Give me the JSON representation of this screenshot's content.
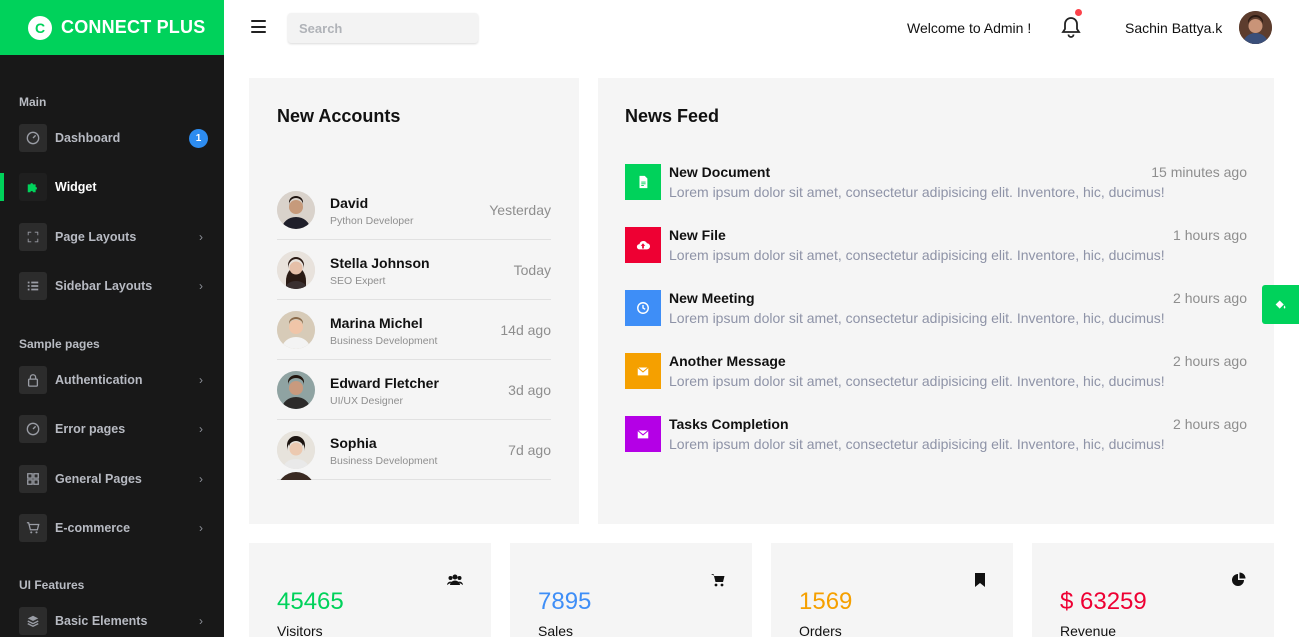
{
  "brand": {
    "name": "CONNECT PLUS",
    "logo_letter": "C"
  },
  "sidebar": {
    "sections": [
      {
        "title": "Main"
      },
      {
        "title": "Sample pages"
      },
      {
        "title": "UI Features"
      }
    ],
    "items": [
      {
        "label": "Dashboard",
        "icon": "gauge-icon",
        "badge": "1",
        "active": false
      },
      {
        "label": "Widget",
        "icon": "puzzle-icon",
        "active": true
      },
      {
        "label": "Page Layouts",
        "icon": "layout-icon",
        "active": false
      },
      {
        "label": "Sidebar Layouts",
        "icon": "list-icon",
        "active": false
      },
      {
        "label": "Authentication",
        "icon": "lock-icon",
        "active": false
      },
      {
        "label": "Error pages",
        "icon": "gauge-icon",
        "active": false
      },
      {
        "label": "General Pages",
        "icon": "grid-icon",
        "active": false
      },
      {
        "label": "E-commerce",
        "icon": "cart-icon",
        "active": false
      },
      {
        "label": "Basic Elements",
        "icon": "layers-icon",
        "active": false
      }
    ],
    "chevron": "›"
  },
  "topbar": {
    "search_placeholder": "Search",
    "welcome": "Welcome to Admin !",
    "username": "Sachin Battya.k",
    "notification_dot": true
  },
  "new_accounts": {
    "title": "New Accounts",
    "rows": [
      {
        "name": "David",
        "role": "Python Developer",
        "time": "Yesterday"
      },
      {
        "name": "Stella Johnson",
        "role": "SEO Expert",
        "time": "Today"
      },
      {
        "name": "Marina Michel",
        "role": "Business Development",
        "time": "14d ago"
      },
      {
        "name": "Edward Fletcher",
        "role": "UI/UX Designer",
        "time": "3d ago"
      },
      {
        "name": "Sophia",
        "role": "Business Development",
        "time": "7d ago"
      }
    ]
  },
  "news_feed": {
    "title": "News Feed",
    "items": [
      {
        "title": "New Document",
        "text": "Lorem ipsum dolor sit amet, consectetur adipisicing elit. Inventore, hic, ducimus!",
        "time": "15 minutes ago",
        "color": "#00d25b",
        "icon": "document-icon"
      },
      {
        "title": "New File",
        "text": "Lorem ipsum dolor sit amet, consectetur adipisicing elit. Inventore, hic, ducimus!",
        "time": "1 hours ago",
        "color": "#ee0033",
        "icon": "cloud-upload-icon"
      },
      {
        "title": "New Meeting",
        "text": "Lorem ipsum dolor sit amet, consectetur adipisicing elit. Inventore, hic, ducimus!",
        "time": "2 hours ago",
        "color": "#3e8ef7",
        "icon": "clock-icon"
      },
      {
        "title": "Another Message",
        "text": "Lorem ipsum dolor sit amet, consectetur adipisicing elit. Inventore, hic, ducimus!",
        "time": "2 hours ago",
        "color": "#f5a000",
        "icon": "mail-icon"
      },
      {
        "title": "Tasks Completion",
        "text": "Lorem ipsum dolor sit amet, consectetur adipisicing elit. Inventore, hic, ducimus!",
        "time": "2 hours ago",
        "color": "#b400e6",
        "icon": "mail-icon"
      }
    ]
  },
  "stats": [
    {
      "value": "45465",
      "label": "Visitors",
      "color": "#00d25b",
      "icon": "users-icon"
    },
    {
      "value": "7895",
      "label": "Sales",
      "color": "#3e8ef7",
      "icon": "cart-icon"
    },
    {
      "value": "1569",
      "label": "Orders",
      "color": "#f5a000",
      "icon": "bookmark-icon"
    },
    {
      "value": "$ 63259",
      "label": "Revenue",
      "color": "#ee0033",
      "icon": "pie-chart-icon"
    }
  ],
  "colors": {
    "accent": "#00d25b",
    "sidebar_bg": "#181818",
    "badge": "#2d8cf0"
  }
}
